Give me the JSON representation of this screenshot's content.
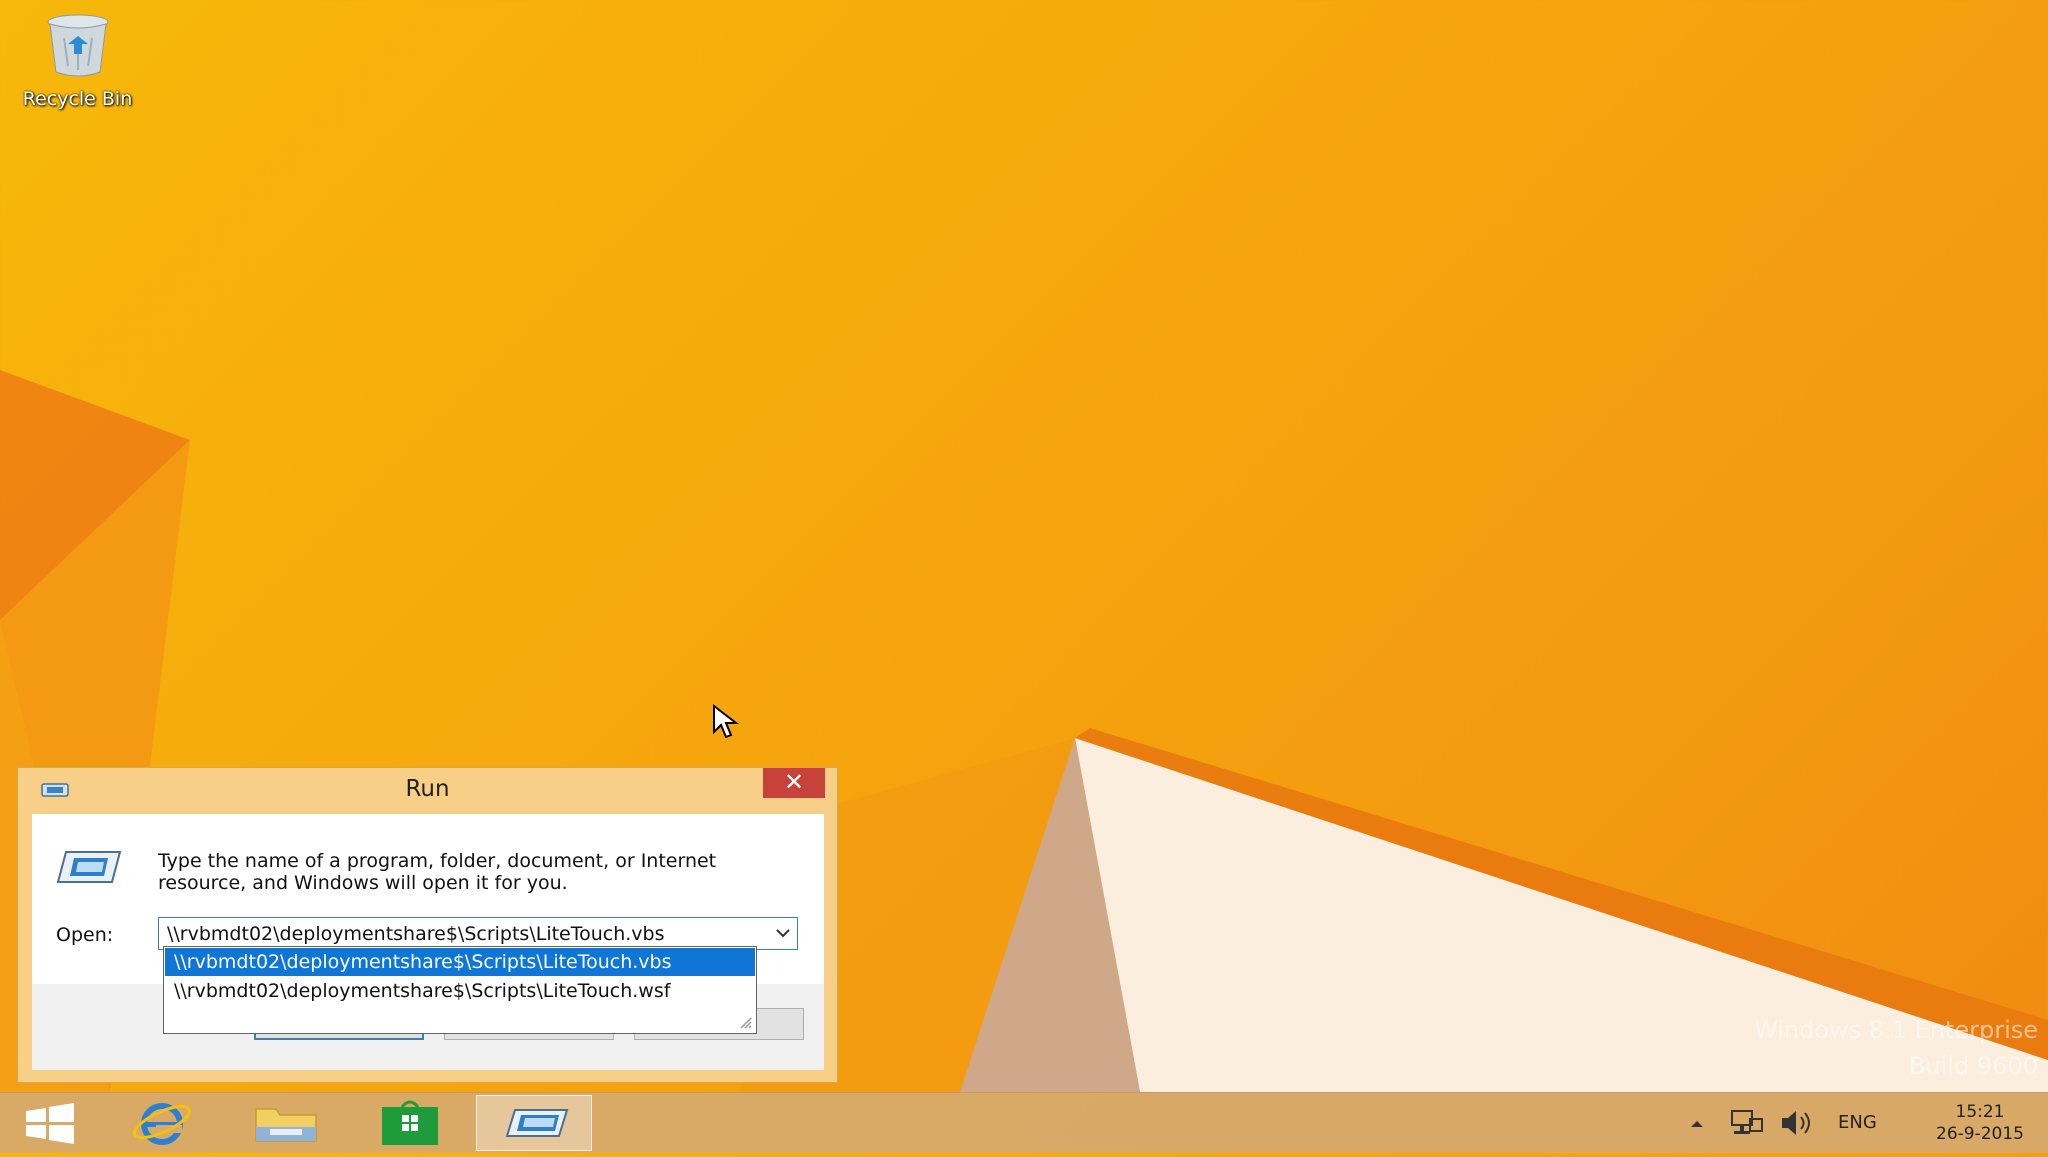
{
  "desktop": {
    "icons": [
      {
        "label": "Recycle Bin",
        "icon": "recycle-bin-icon"
      }
    ],
    "watermark": {
      "line1": "Windows 8.1 Enterprise",
      "line2": "Build 9600"
    }
  },
  "run_dialog": {
    "title": "Run",
    "close_symbol": "✕",
    "message": "Type the name of a program, folder, document, or Internet resource, and Windows will open it for you.",
    "open_label": "Open:",
    "open_value": "\\\\rvbmdt02\\deploymentshare$\\Scripts\\LiteTouch.vbs",
    "dropdown_items": [
      {
        "text": "\\\\rvbmdt02\\deploymentshare$\\Scripts\\LiteTouch.vbs",
        "selected": true
      },
      {
        "text": "\\\\rvbmdt02\\deploymentshare$\\Scripts\\LiteTouch.wsf",
        "selected": false
      }
    ]
  },
  "taskbar": {
    "items": [
      "start-button",
      "internet-explorer",
      "file-explorer",
      "store",
      "run"
    ],
    "tray": {
      "language": "ENG",
      "time": "15:21",
      "date": "26-9-2015"
    }
  },
  "colors": {
    "accent": "#0f76d8",
    "close": "#c7423a",
    "wallpaper": "#f7b80a"
  }
}
